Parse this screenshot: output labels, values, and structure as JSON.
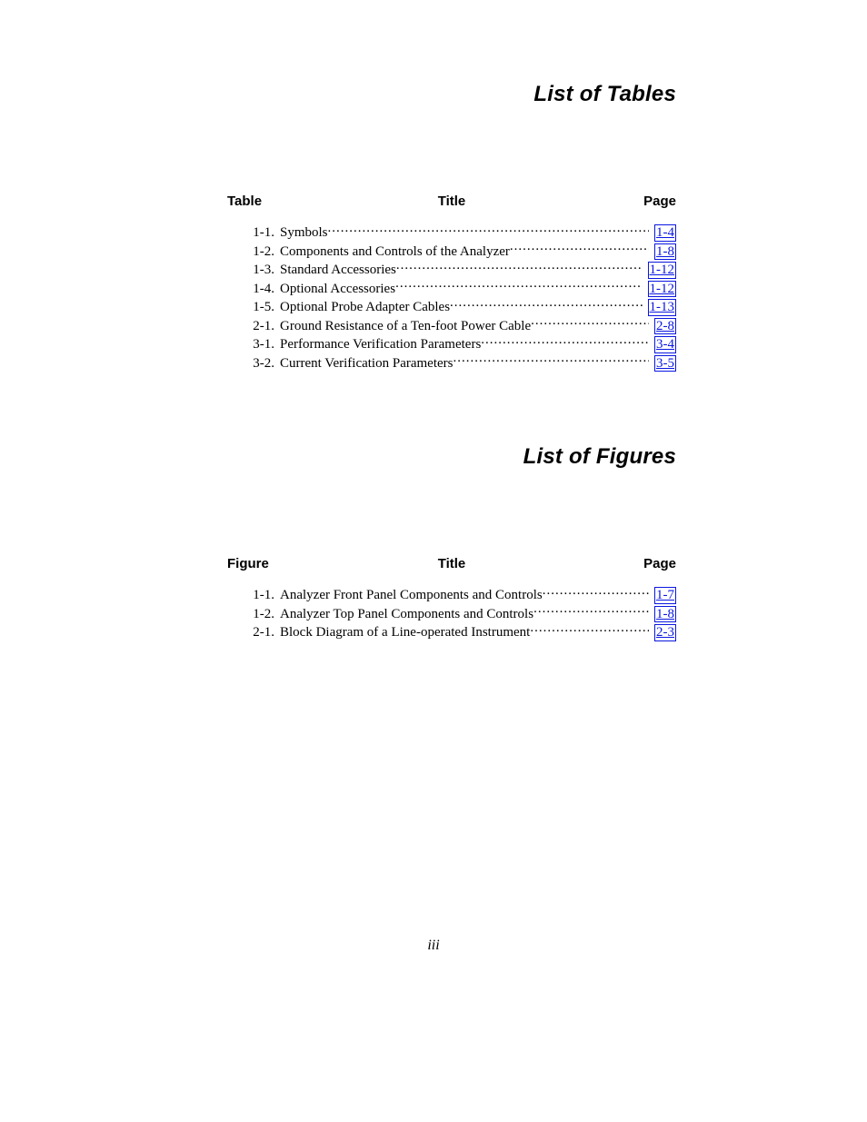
{
  "sections": [
    {
      "title": "List of Tables",
      "header": {
        "left": "Table",
        "mid": "Title",
        "right": "Page"
      },
      "entries": [
        {
          "num": "1-1.",
          "title": "Symbols",
          "page": "1-4"
        },
        {
          "num": "1-2.",
          "title": "Components and Controls of the Analyzer",
          "page": "1-8"
        },
        {
          "num": "1-3.",
          "title": "Standard Accessories",
          "page": "1-12"
        },
        {
          "num": "1-4.",
          "title": "Optional Accessories",
          "page": "1-12"
        },
        {
          "num": "1-5.",
          "title": "Optional Probe Adapter Cables",
          "page": "1-13"
        },
        {
          "num": "2-1.",
          "title": "Ground Resistance of a Ten-foot Power Cable",
          "page": "2-8"
        },
        {
          "num": "3-1.",
          "title": "Performance Verification Parameters",
          "page": "3-4"
        },
        {
          "num": "3-2.",
          "title": "Current Verification Parameters",
          "page": "3-5"
        }
      ]
    },
    {
      "title": "List of Figures",
      "header": {
        "left": "Figure",
        "mid": "Title",
        "right": "Page"
      },
      "entries": [
        {
          "num": "1-1.",
          "title": "Analyzer Front Panel Components and Controls",
          "page": "1-7"
        },
        {
          "num": "1-2.",
          "title": "Analyzer Top Panel Components and Controls",
          "page": "1-8"
        },
        {
          "num": "2-1.",
          "title": "Block Diagram of a Line-operated Instrument",
          "page": "2-3"
        }
      ]
    }
  ],
  "page_number": "iii"
}
